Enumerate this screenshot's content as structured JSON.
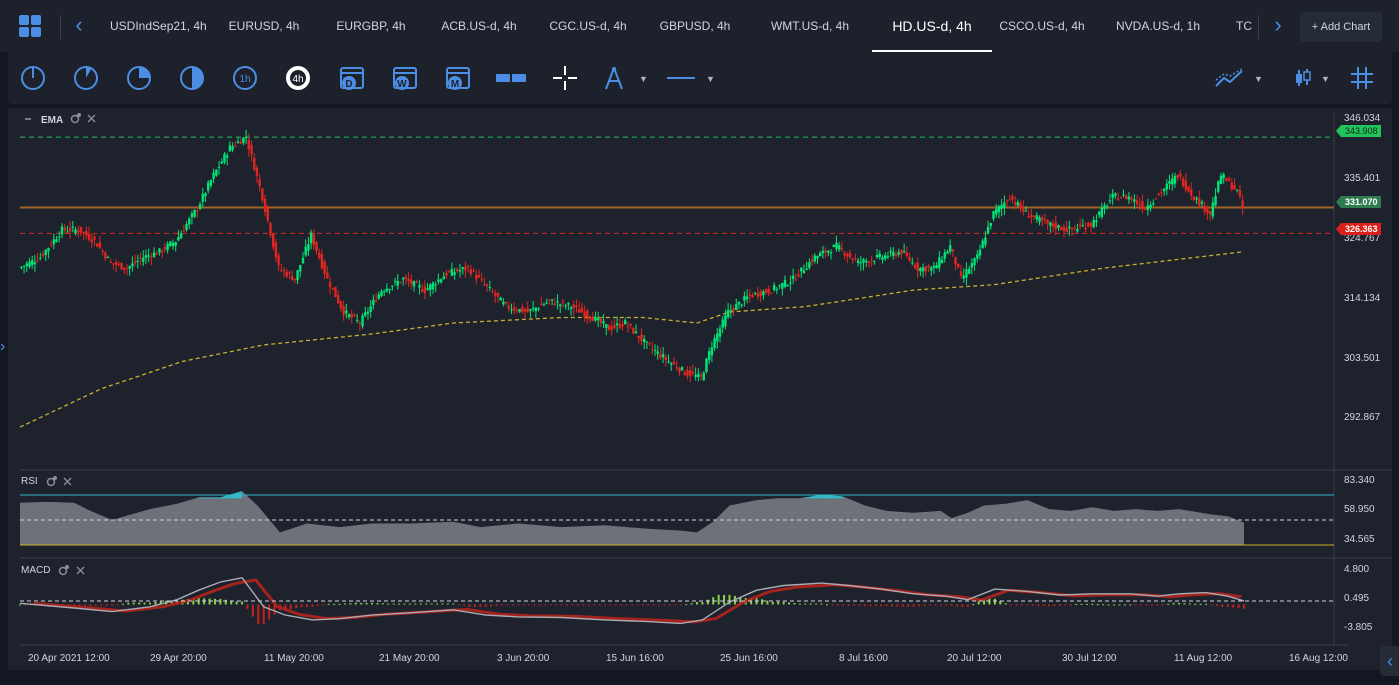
{
  "tabs": [
    {
      "label": "USDIndSep21, 4h"
    },
    {
      "label": "EURUSD, 4h"
    },
    {
      "label": "EURGBP, 4h"
    },
    {
      "label": "ACB.US-d, 4h"
    },
    {
      "label": "CGC.US-d, 4h"
    },
    {
      "label": "GBPUSD, 4h"
    },
    {
      "label": "WMT.US-d, 4h"
    },
    {
      "label": "HD.US-d, 4h",
      "active": true
    },
    {
      "label": "CSCO.US-d, 4h"
    },
    {
      "label": "NVDA.US-d, 1h"
    },
    {
      "label": "TC"
    }
  ],
  "add_chart": "+ Add Chart",
  "toolbar": {
    "timeframes": [
      {
        "name": "1m",
        "icon": "clock-1m-icon"
      },
      {
        "name": "5m",
        "icon": "clock-5m-icon"
      },
      {
        "name": "15m",
        "icon": "clock-15m-icon"
      },
      {
        "name": "30m",
        "icon": "clock-30m-icon"
      },
      {
        "name": "1h",
        "label": "1h",
        "icon": "clock-1h-icon"
      },
      {
        "name": "4h",
        "label": "4h",
        "icon": "clock-4h-icon",
        "active": true
      },
      {
        "name": "D",
        "label": "D",
        "icon": "calendar-day-icon"
      },
      {
        "name": "W",
        "label": "W",
        "icon": "calendar-week-icon"
      },
      {
        "name": "M",
        "label": "M",
        "icon": "calendar-month-icon"
      }
    ]
  },
  "colors": {
    "up": "#00e676",
    "down": "#e0261f",
    "accent": "#4c8ee3",
    "ema": "#c9b12d",
    "resistance": "#22c35a",
    "current": "#a0652a",
    "support": "#e0261f",
    "rsi_upper": "#32b8c6",
    "rsi_lower": "#c9b12d"
  },
  "main": {
    "indicator_label": "EMA",
    "price_axis": [
      "346.034",
      "335.401",
      "324.767",
      "314.134",
      "303.501",
      "292.867"
    ],
    "lines": {
      "resistance": {
        "value": 343.908,
        "label": "343.908"
      },
      "current": {
        "value": 331.07,
        "label": "331.070"
      },
      "support": {
        "value": 326.363,
        "label": "326.363"
      }
    }
  },
  "rsi": {
    "label": "RSI",
    "axis": [
      "83.340",
      "58.950",
      "34.565"
    ]
  },
  "macd": {
    "label": "MACD",
    "axis": [
      "4.800",
      "0.495",
      "-3.805"
    ]
  },
  "time_axis": [
    "20 Apr 2021 12:00",
    "29 Apr 20:00",
    "11 May 20:00",
    "21 May 20:00",
    "3 Jun 20:00",
    "15 Jun 16:00",
    "25 Jun 16:00",
    "8 Jul 16:00",
    "20 Jul 12:00",
    "30 Jul 12:00",
    "11 Aug 12:00",
    "16 Aug 12:00"
  ],
  "chart_data": {
    "type": "candlestick",
    "series_path": [
      [
        0,
        320
      ],
      [
        8,
        322
      ],
      [
        16,
        327
      ],
      [
        22,
        327
      ],
      [
        28,
        325
      ],
      [
        34,
        321
      ],
      [
        40,
        320
      ],
      [
        46,
        322
      ],
      [
        52,
        323
      ],
      [
        58,
        325
      ],
      [
        66,
        331
      ],
      [
        72,
        337
      ],
      [
        78,
        342
      ],
      [
        84,
        344
      ],
      [
        90,
        333
      ],
      [
        96,
        320
      ],
      [
        102,
        318
      ],
      [
        108,
        326
      ],
      [
        114,
        318
      ],
      [
        120,
        312
      ],
      [
        126,
        310
      ],
      [
        134,
        316
      ],
      [
        142,
        318
      ],
      [
        150,
        316
      ],
      [
        158,
        319
      ],
      [
        166,
        320
      ],
      [
        174,
        316
      ],
      [
        180,
        313
      ],
      [
        188,
        312
      ],
      [
        196,
        314
      ],
      [
        204,
        313
      ],
      [
        212,
        311
      ],
      [
        218,
        309
      ],
      [
        224,
        310
      ],
      [
        232,
        306
      ],
      [
        240,
        303
      ],
      [
        246,
        301
      ],
      [
        252,
        300
      ],
      [
        256,
        306
      ],
      [
        262,
        312
      ],
      [
        270,
        315
      ],
      [
        278,
        316
      ],
      [
        286,
        318
      ],
      [
        294,
        322
      ],
      [
        302,
        324
      ],
      [
        310,
        321
      ],
      [
        318,
        322
      ],
      [
        326,
        323
      ],
      [
        332,
        320
      ],
      [
        338,
        320
      ],
      [
        344,
        324
      ],
      [
        348,
        318
      ],
      [
        354,
        322
      ],
      [
        360,
        330
      ],
      [
        366,
        333
      ],
      [
        372,
        330
      ],
      [
        380,
        328
      ],
      [
        388,
        327
      ],
      [
        396,
        328
      ],
      [
        404,
        333
      ],
      [
        410,
        333
      ],
      [
        416,
        331
      ],
      [
        422,
        334
      ],
      [
        428,
        337
      ],
      [
        434,
        333
      ],
      [
        440,
        330
      ],
      [
        444,
        337
      ],
      [
        450,
        334
      ],
      [
        452,
        331
      ]
    ],
    "ema": [
      [
        0,
        291
      ],
      [
        30,
        298
      ],
      [
        60,
        303
      ],
      [
        90,
        306
      ],
      [
        130,
        308
      ],
      [
        160,
        310
      ],
      [
        200,
        311
      ],
      [
        230,
        311
      ],
      [
        250,
        310
      ],
      [
        262,
        312
      ],
      [
        290,
        313
      ],
      [
        330,
        316
      ],
      [
        360,
        317
      ],
      [
        400,
        320
      ],
      [
        452,
        323
      ]
    ],
    "rsi": [
      [
        0,
        67
      ],
      [
        10,
        68
      ],
      [
        20,
        67
      ],
      [
        26,
        58
      ],
      [
        34,
        48
      ],
      [
        48,
        60
      ],
      [
        58,
        66
      ],
      [
        66,
        73
      ],
      [
        74,
        73
      ],
      [
        82,
        80
      ],
      [
        88,
        63
      ],
      [
        96,
        34
      ],
      [
        106,
        44
      ],
      [
        118,
        40
      ],
      [
        130,
        44
      ],
      [
        144,
        44
      ],
      [
        160,
        46
      ],
      [
        170,
        40
      ],
      [
        184,
        44
      ],
      [
        200,
        40
      ],
      [
        216,
        42
      ],
      [
        232,
        38
      ],
      [
        244,
        36
      ],
      [
        250,
        34
      ],
      [
        256,
        46
      ],
      [
        262,
        64
      ],
      [
        272,
        70
      ],
      [
        280,
        72
      ],
      [
        288,
        72
      ],
      [
        296,
        76
      ],
      [
        304,
        74
      ],
      [
        312,
        64
      ],
      [
        320,
        58
      ],
      [
        330,
        56
      ],
      [
        340,
        58
      ],
      [
        344,
        50
      ],
      [
        350,
        56
      ],
      [
        356,
        64
      ],
      [
        364,
        66
      ],
      [
        372,
        70
      ],
      [
        380,
        60
      ],
      [
        388,
        58
      ],
      [
        396,
        62
      ],
      [
        404,
        58
      ],
      [
        412,
        60
      ],
      [
        420,
        58
      ],
      [
        428,
        60
      ],
      [
        434,
        57
      ],
      [
        440,
        54
      ],
      [
        446,
        52
      ],
      [
        452,
        45
      ]
    ],
    "macd": [
      [
        0,
        0.2
      ],
      [
        20,
        -0.6
      ],
      [
        34,
        -1.2
      ],
      [
        48,
        -0.4
      ],
      [
        58,
        0.8
      ],
      [
        66,
        2.4
      ],
      [
        74,
        3.8
      ],
      [
        82,
        4.5
      ],
      [
        90,
        -0.4
      ],
      [
        98,
        -1.8
      ],
      [
        108,
        -2.6
      ],
      [
        118,
        -2.4
      ],
      [
        130,
        -1.8
      ],
      [
        144,
        -1.4
      ],
      [
        160,
        -0.9
      ],
      [
        172,
        -1.8
      ],
      [
        184,
        -2.1
      ],
      [
        200,
        -2.2
      ],
      [
        216,
        -2.6
      ],
      [
        232,
        -2.9
      ],
      [
        244,
        -3.2
      ],
      [
        252,
        -2.6
      ],
      [
        262,
        0.4
      ],
      [
        272,
        2.4
      ],
      [
        282,
        3.2
      ],
      [
        296,
        3.6
      ],
      [
        306,
        3.2
      ],
      [
        318,
        2.6
      ],
      [
        330,
        1.8
      ],
      [
        342,
        1.4
      ],
      [
        350,
        0.8
      ],
      [
        360,
        2.6
      ],
      [
        372,
        2.2
      ],
      [
        384,
        1.6
      ],
      [
        396,
        1.8
      ],
      [
        410,
        1.8
      ],
      [
        420,
        1.4
      ],
      [
        428,
        1.8
      ],
      [
        438,
        2.0
      ],
      [
        446,
        1.4
      ],
      [
        452,
        0.6
      ]
    ],
    "x_domain": [
      0,
      452
    ],
    "y_domain": [
      285,
      348.5
    ],
    "rsi_domain": [
      20,
      98
    ],
    "macd_domain": [
      -6,
      7
    ]
  }
}
